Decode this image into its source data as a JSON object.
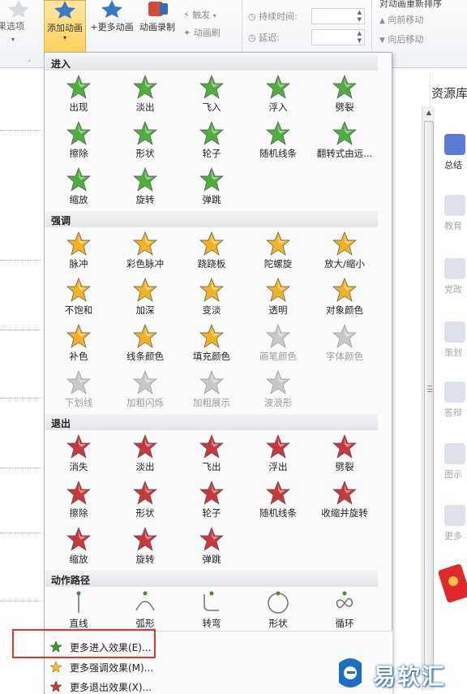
{
  "ribbon": {
    "effect_options": "效果选项",
    "add_animation": "添加动画",
    "more_animation": "+更多动画",
    "record": "动画录制",
    "trigger": "触发",
    "anim_brush": "动画刷",
    "duration_label": "持续时间:",
    "delay_label": "延迟:",
    "reorder_title": "对动画重新排序",
    "move_earlier": "向前移动",
    "move_later": "向后移动"
  },
  "right_panel": {
    "title": "资源库",
    "items": [
      "总结",
      "教育",
      "党政",
      "策划",
      "答辩",
      "图示",
      "更多"
    ]
  },
  "gallery": {
    "sections": [
      {
        "title": "进入",
        "color": "#4fae3f",
        "items": [
          "出现",
          "淡出",
          "飞入",
          "浮入",
          "劈裂",
          "擦除",
          "形状",
          "轮子",
          "随机线条",
          "翻转式由远...",
          "缩放",
          "旋转",
          "弹跳"
        ]
      },
      {
        "title": "强调",
        "color": "#f2b322",
        "items": [
          "脉冲",
          "彩色脉冲",
          "跷跷板",
          "陀螺旋",
          "放大/缩小",
          "不饱和",
          "加深",
          "变淡",
          "透明",
          "对象颜色",
          "补色",
          "线条颜色",
          "填充颜色",
          "画笔颜色",
          "字体颜色",
          "下划线",
          "加粗闪烁",
          "加粗展示",
          "波浪形"
        ],
        "disabled": [
          13,
          14,
          15,
          16,
          17,
          18
        ]
      },
      {
        "title": "退出",
        "color": "#c8373d",
        "items": [
          "消失",
          "淡出",
          "飞出",
          "浮出",
          "劈裂",
          "擦除",
          "形状",
          "轮子",
          "随机线条",
          "收缩并旋转",
          "缩放",
          "旋转",
          "弹跳"
        ]
      },
      {
        "title": "动作路径",
        "color": "#4a8a3a",
        "items": [
          "直线",
          "弧形",
          "转弯",
          "形状",
          "循环"
        ]
      }
    ],
    "more_entrance": "更多进入效果(E)...",
    "more_emphasis": "更多强调效果(M)...",
    "more_exit": "更多退出效果(X)..."
  },
  "watermark": "易软汇"
}
